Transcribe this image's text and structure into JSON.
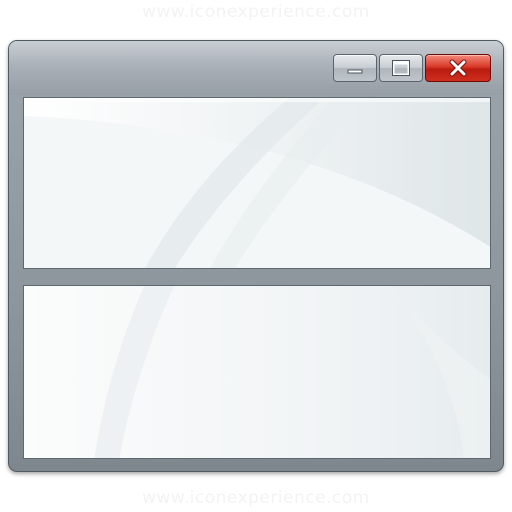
{
  "watermark": {
    "top_text": "www.iconexperience.com",
    "bottom_text": "www.iconexperience.com"
  },
  "window": {
    "buttons": {
      "minimize_icon": "minimize-icon",
      "maximize_icon": "maximize-icon",
      "close_icon": "close-x-icon"
    },
    "colors": {
      "frame": "#8d959d",
      "titlebar": "#aab1b8",
      "pane": "#f7f9fa",
      "close_button": "#d93a28"
    }
  }
}
